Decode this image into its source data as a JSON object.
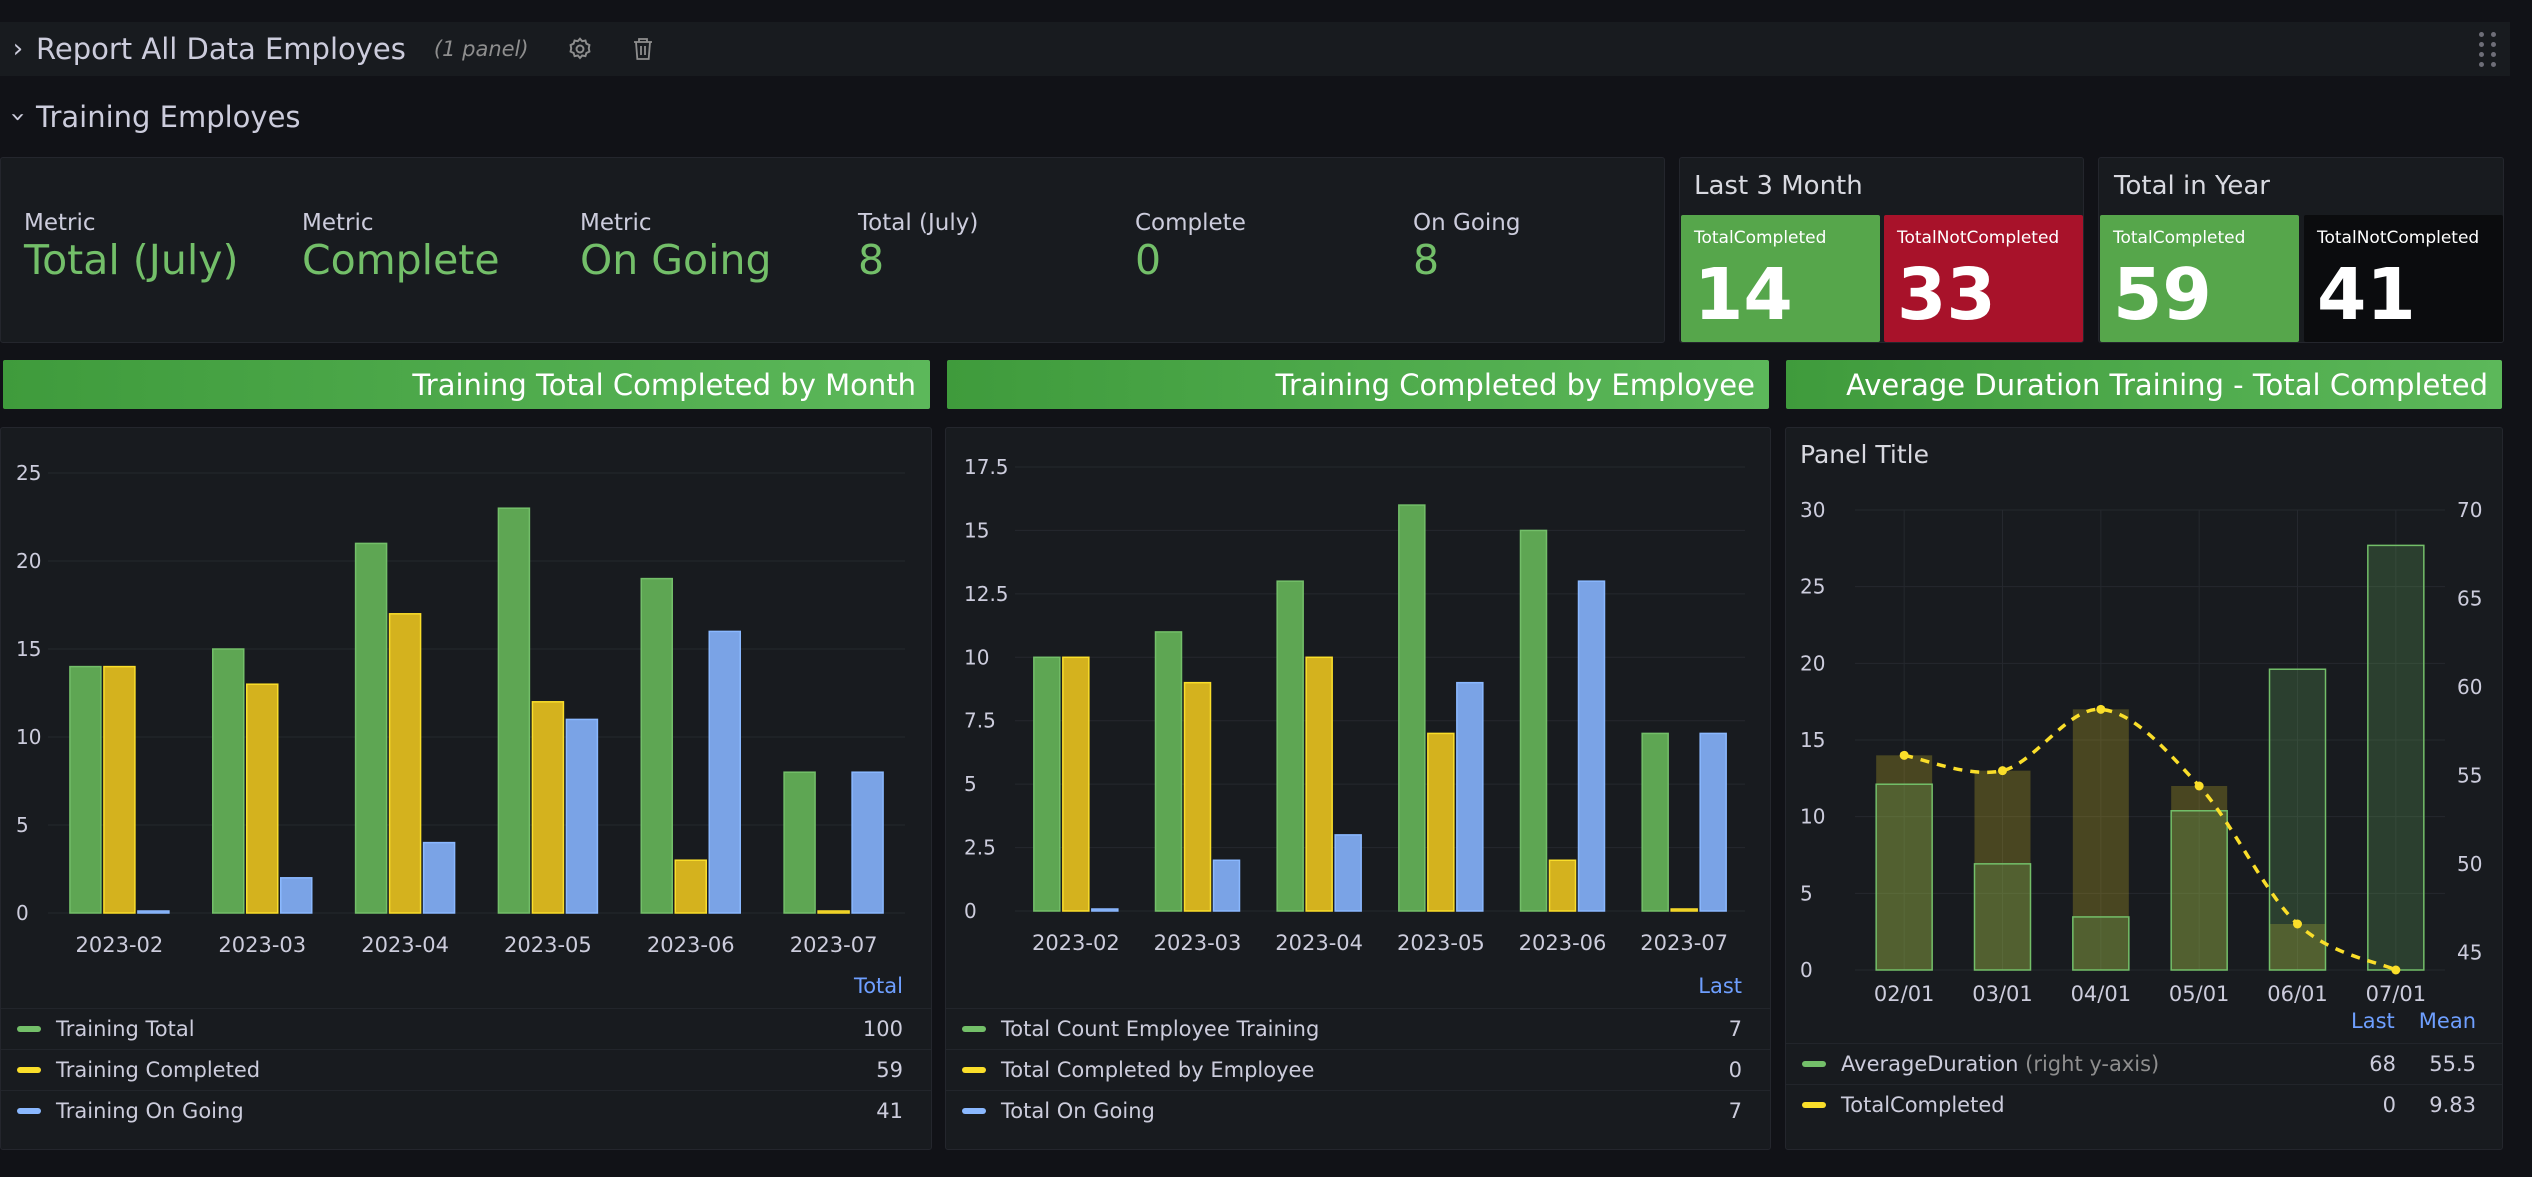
{
  "rows": [
    {
      "title": "Report All Data Employes",
      "chevron": "›",
      "subtitle": "(1 panel)"
    },
    {
      "title": "Training Employes",
      "chevron": "›"
    }
  ],
  "stats": [
    {
      "label": "Metric",
      "value": "Total (July)"
    },
    {
      "label": "Metric",
      "value": "Complete"
    },
    {
      "label": "Metric",
      "value": "On Going"
    },
    {
      "label": "Total (July)",
      "value": "8"
    },
    {
      "label": "Complete",
      "value": "0"
    },
    {
      "label": "On Going",
      "value": "8"
    }
  ],
  "last3": {
    "title": "Last 3 Month",
    "completed_label": "TotalCompleted",
    "completed_value": "14",
    "not_label": "TotalNotCompleted",
    "not_value": "33"
  },
  "year": {
    "title": "Total in Year",
    "completed_label": "TotalCompleted",
    "completed_value": "59",
    "not_label": "TotalNotCompleted",
    "not_value": "41"
  },
  "banners": [
    "Training Total Completed by Month",
    "Training Completed by Employee",
    "Average Duration Training - Total Completed"
  ],
  "colors": {
    "green": "#73bf69",
    "yellow": "#fade2a",
    "blue": "#8ab8ff",
    "red": "#c4162a",
    "dark_green": "#56a64b"
  },
  "chart_data": [
    {
      "type": "bar",
      "categories": [
        "2023-02",
        "2023-03",
        "2023-04",
        "2023-05",
        "2023-06",
        "2023-07"
      ],
      "ylim": [
        0,
        25
      ],
      "yticks": [
        "0",
        "5",
        "10",
        "15",
        "20",
        "25"
      ],
      "series": [
        {
          "name": "Training Total",
          "values": [
            14,
            15,
            21,
            23,
            19,
            8
          ]
        },
        {
          "name": "Training Completed",
          "values": [
            14,
            13,
            17,
            12,
            3,
            0
          ]
        },
        {
          "name": "Training On Going",
          "values": [
            0,
            2,
            4,
            11,
            16,
            8
          ]
        }
      ],
      "legend_header": "Total",
      "legend_values": [
        "100",
        "59",
        "41"
      ]
    },
    {
      "type": "bar",
      "categories": [
        "2023-02",
        "2023-03",
        "2023-04",
        "2023-05",
        "2023-06",
        "2023-07"
      ],
      "ylim": [
        0,
        17.5
      ],
      "yticks": [
        "0",
        "2.5",
        "5",
        "7.5",
        "10",
        "12.5",
        "15",
        "17.5"
      ],
      "series": [
        {
          "name": "Total Count Employee Training",
          "values": [
            10,
            11,
            13,
            16,
            15,
            7
          ]
        },
        {
          "name": "Total Completed by Employee",
          "values": [
            10,
            9,
            10,
            7,
            2,
            0
          ]
        },
        {
          "name": "Total On Going",
          "values": [
            0,
            2,
            3,
            9,
            13,
            7
          ]
        }
      ],
      "legend_header": "Last",
      "legend_values": [
        "7",
        "0",
        "7"
      ]
    },
    {
      "type": "bar",
      "title": "Panel Title",
      "categories": [
        "02/01",
        "03/01",
        "04/01",
        "05/01",
        "06/01",
        "07/01"
      ],
      "ylim": [
        0,
        30
      ],
      "yticks": [
        "0",
        "5",
        "10",
        "15",
        "20",
        "25",
        "30"
      ],
      "ylim_right": [
        44,
        70
      ],
      "yticks_right": [
        "45",
        "50",
        "55",
        "60",
        "65",
        "70"
      ],
      "series": [
        {
          "name": "AverageDuration",
          "axis": "right",
          "values": [
            54.5,
            50,
            47,
            53,
            61,
            68
          ]
        },
        {
          "name": "TotalCompleted",
          "axis": "left",
          "values": [
            14,
            13,
            17,
            12,
            3,
            0
          ]
        }
      ],
      "legend_headers": [
        "Last",
        "Mean"
      ],
      "legend_note": "(right y-axis)",
      "legend_values": [
        [
          "68",
          "55.5"
        ],
        [
          "0",
          "9.83"
        ]
      ]
    }
  ]
}
